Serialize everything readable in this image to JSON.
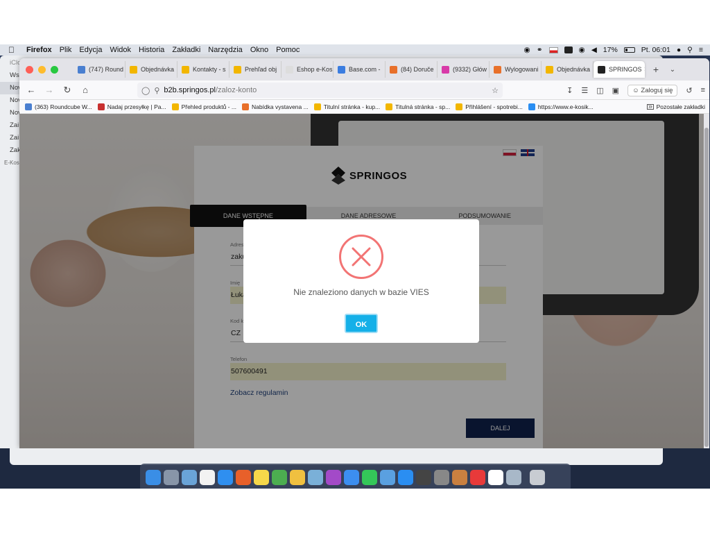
{
  "menubar": {
    "app_name": "Firefox",
    "items": [
      "Plik",
      "Edycja",
      "Widok",
      "Historia",
      "Zakładki",
      "Narzędzia",
      "Okno",
      "Pomoc"
    ],
    "battery": "17%",
    "clock": "Pt. 06:01"
  },
  "background_app": {
    "sidebar_items": [
      "iCloud",
      "Ws",
      "Nov",
      "Nov",
      "Nov",
      "Zai",
      "Zai",
      "Zak",
      "E-Kos"
    ]
  },
  "browser": {
    "tabs": [
      {
        "label": "(747) Round",
        "color": "#4a7fd0"
      },
      {
        "label": "Objednávka",
        "color": "#f2b600"
      },
      {
        "label": "Kontakty - s",
        "color": "#f2b600"
      },
      {
        "label": "Prehľad obj",
        "color": "#f2b600"
      },
      {
        "label": "Eshop e-Kos",
        "color": "#dddddd"
      },
      {
        "label": "Base.com -",
        "color": "#3b7de0"
      },
      {
        "label": "(84) Doruče",
        "color": "#e8702a"
      },
      {
        "label": "(9332) Głów",
        "color": "#d83aa8"
      },
      {
        "label": "Wylogowani",
        "color": "#e8702a"
      },
      {
        "label": "Objednávka",
        "color": "#f2b600"
      },
      {
        "label": "SPRINGOS",
        "color": "#222222",
        "active": true
      }
    ],
    "url_domain": "b2b.springos.pl",
    "url_path": "/zaloz-konto",
    "login_label": "Zaloguj się",
    "bookmarks": [
      "(363) Roundcube W...",
      "Nadaj przesyłkę | Pa...",
      "Přehled produktů - ...",
      "Nabídka vystavena ...",
      "Titulní stránka - kup...",
      "Titulná stránka - sp...",
      "Přihlášení - spotrebi...",
      "https://www.e-kosik..."
    ],
    "other_bookmarks": "Pozostałe zakładki"
  },
  "page": {
    "logo_text": "SPRINGOS",
    "steps": [
      "DANE WSTĘPNE",
      "DANE ADRESOWE",
      "PODSUMOWANIE"
    ],
    "fields": {
      "email": {
        "label": "Adres",
        "value": "zaku"
      },
      "name": {
        "label": "Imię",
        "value": "Łuka"
      },
      "country_code": {
        "label": "Kod k",
        "value": "CZ"
      },
      "phone": {
        "label": "Telefon",
        "value": "507600491"
      }
    },
    "terms_link": "Zobacz regulamin",
    "next_button": "DALEJ"
  },
  "modal": {
    "message": "Nie znaleziono danych w bazie VIES",
    "ok_label": "OK",
    "error_color": "#f27474",
    "button_color": "#15b0e8"
  }
}
